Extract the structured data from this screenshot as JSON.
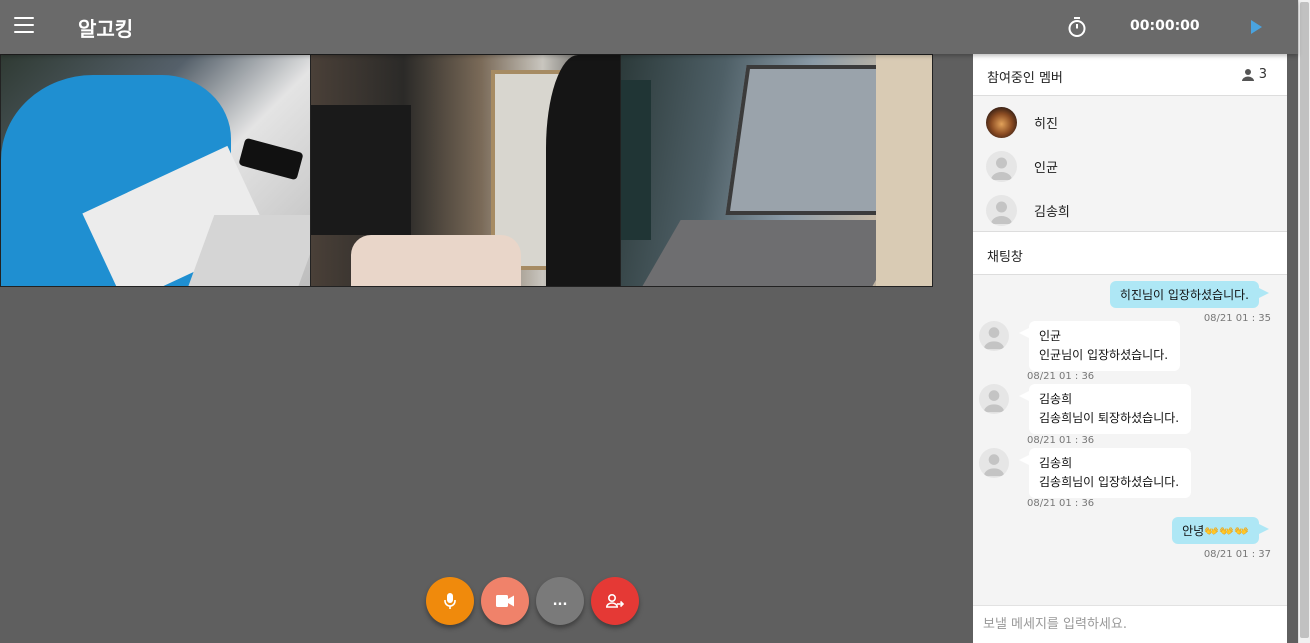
{
  "header": {
    "app_title": "알고킹",
    "timer": "00:00:00",
    "icons": {
      "menu": "menu-icon",
      "timer": "stopwatch-icon",
      "play": "play-icon"
    }
  },
  "controls": {
    "more_label": "...",
    "colors": {
      "mic": "#f08a0c",
      "camera": "#f0826a",
      "more": "#7a7a7a",
      "leave": "#e53935"
    }
  },
  "members": {
    "title": "참여중인 멤버",
    "count": "3",
    "list": [
      {
        "name": "히진"
      },
      {
        "name": "인균"
      },
      {
        "name": "김송희"
      }
    ]
  },
  "chat": {
    "title": "채팅창",
    "messages": [
      {
        "side": "right",
        "text": "히진님이 입장하셨습니다.",
        "time": "08/21 01 : 35"
      },
      {
        "side": "left",
        "sender": "인균",
        "text": "인균님이 입장하셨습니다.",
        "time": "08/21 01 : 36"
      },
      {
        "side": "left",
        "sender": "김송희",
        "text": "김송희님이 퇴장하셨습니다.",
        "time": "08/21 01 : 36"
      },
      {
        "side": "left",
        "sender": "김송희",
        "text": "김송희님이 입장하셨습니다.",
        "time": "08/21 01 : 36"
      },
      {
        "side": "right",
        "text": "안녕👐👐👐",
        "time": "08/21 01 : 37"
      }
    ],
    "input_placeholder": "보낼 메세지를 입력하세요."
  }
}
